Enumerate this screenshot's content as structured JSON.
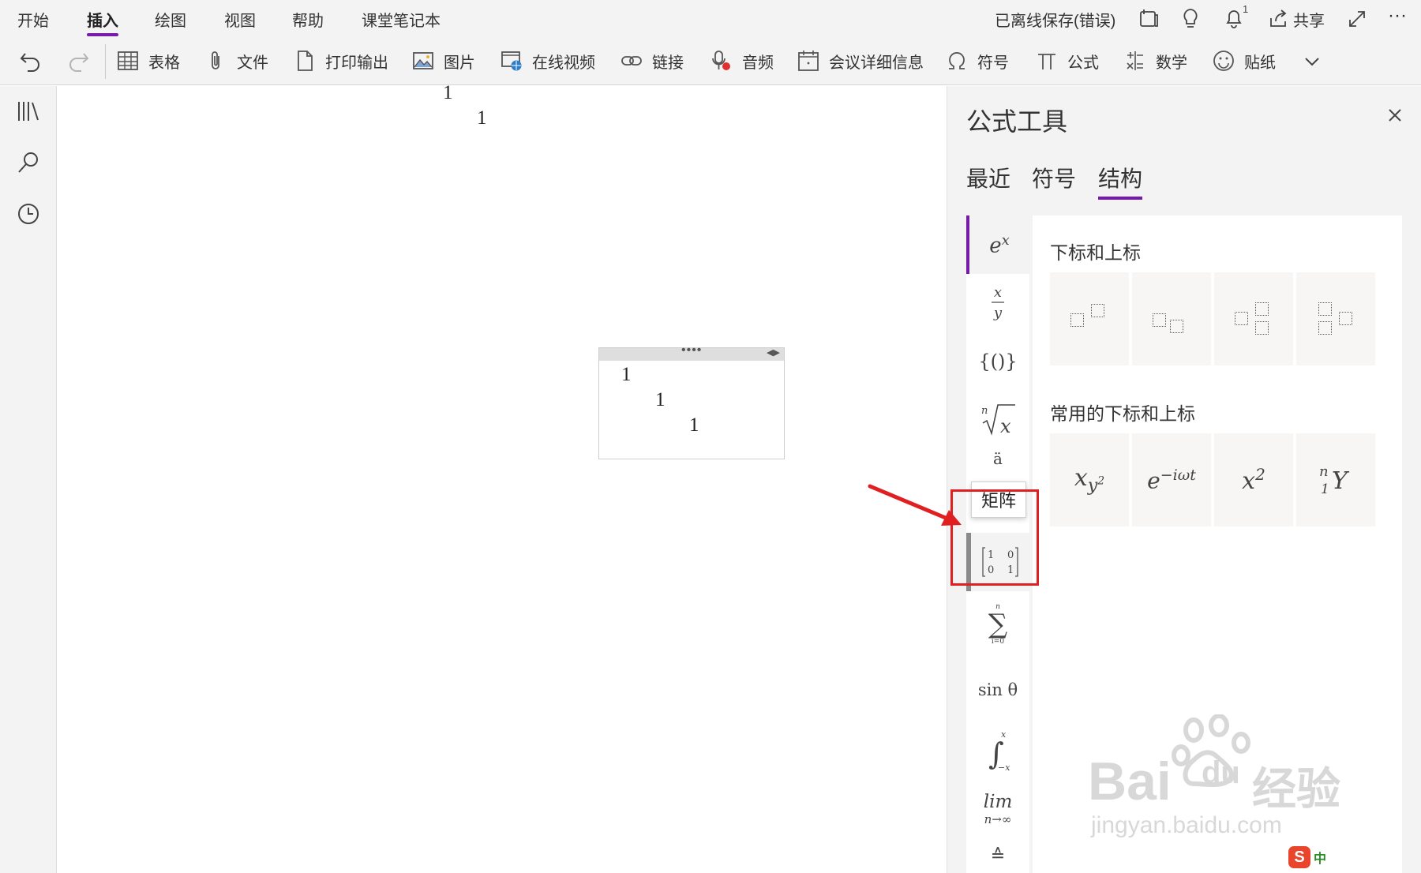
{
  "menu": {
    "tabs": [
      {
        "label": "开始",
        "active": false
      },
      {
        "label": "插入",
        "active": true
      },
      {
        "label": "绘图",
        "active": false
      },
      {
        "label": "视图",
        "active": false
      },
      {
        "label": "帮助",
        "active": false
      },
      {
        "label": "课堂笔记本",
        "active": false
      }
    ],
    "status": "已离线保存(错误)",
    "notification_count": "1",
    "share_label": "共享",
    "more": "···"
  },
  "toolbar": {
    "undo_icon": "undo-icon",
    "redo_icon": "redo-icon",
    "buttons": [
      {
        "label": "表格",
        "icon": "table-icon"
      },
      {
        "label": "文件",
        "icon": "paperclip-icon"
      },
      {
        "label": "打印输出",
        "icon": "page-icon"
      },
      {
        "label": "图片",
        "icon": "picture-icon"
      },
      {
        "label": "在线视频",
        "icon": "online-video-icon"
      },
      {
        "label": "链接",
        "icon": "link-icon"
      },
      {
        "label": "音频",
        "icon": "audio-icon"
      },
      {
        "label": "会议详细信息",
        "icon": "calendar-icon"
      },
      {
        "label": "符号",
        "icon": "omega-icon"
      },
      {
        "label": "公式",
        "icon": "pi-icon"
      },
      {
        "label": "数学",
        "icon": "math-icon"
      },
      {
        "label": "贴纸",
        "icon": "sticker-icon"
      }
    ],
    "expand_icon": "chevron-down-icon"
  },
  "canvas": {
    "top_numbers": [
      "1",
      "1"
    ],
    "equation_numbers": [
      "1",
      "1",
      "1"
    ]
  },
  "pane": {
    "title": "公式工具",
    "tabs": [
      {
        "label": "最近",
        "active": false
      },
      {
        "label": "符号",
        "active": false
      },
      {
        "label": "结构",
        "active": true
      }
    ],
    "categories": [
      {
        "name": "scripts",
        "selected": true
      },
      {
        "name": "fraction"
      },
      {
        "name": "brackets"
      },
      {
        "name": "radical"
      },
      {
        "name": "accent"
      },
      {
        "name": "matrix",
        "hovered": true
      },
      {
        "name": "large-operator"
      },
      {
        "name": "function",
        "label": "sin θ"
      },
      {
        "name": "integral"
      },
      {
        "name": "limit",
        "label_top": "lim",
        "label_bottom": "n→∞"
      },
      {
        "name": "operator"
      }
    ],
    "tooltip": "矩阵",
    "sections": [
      {
        "title": "下标和上标",
        "tiles": [
          "subscript-superscript-template",
          "subscript-template",
          "superscript-subscript-stacked-template",
          "left-subscript-superscript-template"
        ]
      },
      {
        "title": "常用的下标和上标",
        "tiles": [
          "x_{y^2}",
          "e^{-iωt}",
          "x^2",
          "ⁿ₁Y"
        ]
      }
    ]
  },
  "watermark": {
    "brand": "Bai",
    "brand2": "du",
    "brand_suffix": "经验",
    "url": "jingyan.baidu.com"
  },
  "ime": {
    "label": "中",
    "logo": "S"
  }
}
